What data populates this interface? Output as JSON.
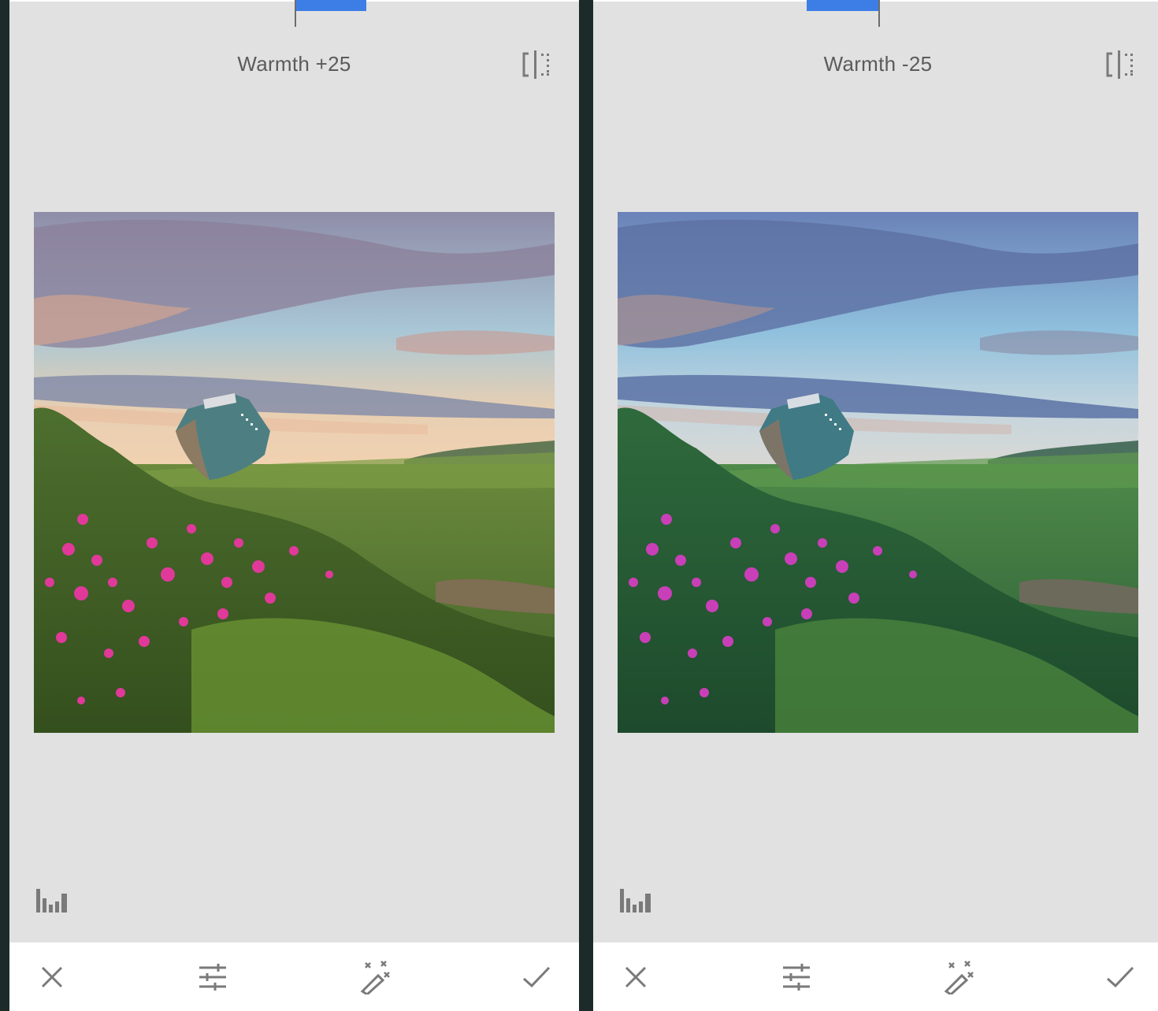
{
  "panels": [
    {
      "id": "left",
      "adjustment_label": "Warmth +25",
      "warmth_value": 25,
      "slider_fill_start_fraction": 0.502,
      "slider_fill_end_fraction": 0.627,
      "photo_tint": "warm",
      "icons": {
        "compare": "compare-icon",
        "histogram": "histogram-icon",
        "cancel": "close-icon",
        "tune": "tune-sliders-icon",
        "auto": "magic-wand-icon",
        "apply": "checkmark-icon"
      }
    },
    {
      "id": "right",
      "adjustment_label": "Warmth -25",
      "warmth_value": -25,
      "slider_fill_start_fraction": 0.375,
      "slider_fill_end_fraction": 0.502,
      "photo_tint": "cool",
      "icons": {
        "compare": "compare-icon",
        "histogram": "histogram-icon",
        "cancel": "close-icon",
        "tune": "tune-sliders-icon",
        "auto": "magic-wand-icon",
        "apply": "checkmark-icon"
      }
    }
  ],
  "colors": {
    "accent": "#3d7ee6",
    "panel_bg": "#e1e1e1",
    "toolbar_bg": "#ffffff",
    "icon": "#7a7a7a",
    "label": "#5b5b5b",
    "page_bg": "#1c2b29"
  }
}
